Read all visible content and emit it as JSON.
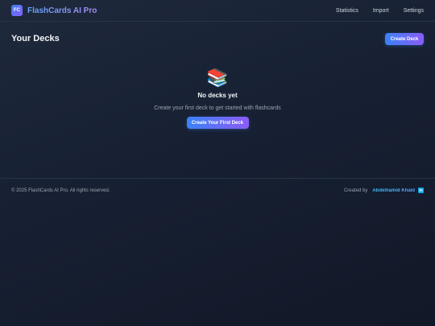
{
  "header": {
    "logo_text": "FC",
    "app_title": "FlashCards AI Pro",
    "nav": [
      "Statistics",
      "Import",
      "Settings"
    ]
  },
  "main": {
    "title": "Your Decks",
    "create_deck_label": "Create Deck",
    "empty_state": {
      "icon": "books-icon",
      "title": "No decks yet",
      "subtitle": "Create your first deck to get started with flashcards",
      "button_label": "Create Your First Deck"
    }
  },
  "footer": {
    "copyright": "© 2025 FlashCards AI Pro. All rights reserved.",
    "created_by": "Created by",
    "author": "Abdelhamid Khald",
    "social_icon": "linkedin-icon"
  },
  "colors": {
    "accent_start": "#3b82f6",
    "accent_end": "#8b5cf6",
    "background": "#172033"
  }
}
